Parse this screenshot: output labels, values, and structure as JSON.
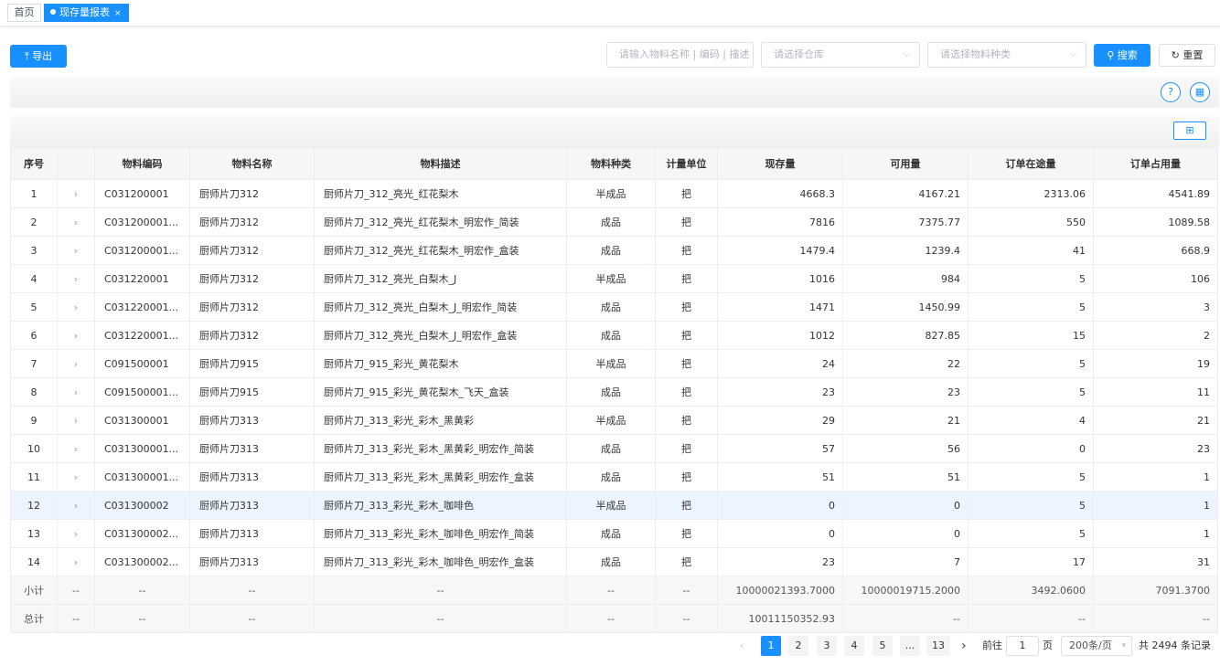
{
  "tabs": {
    "home": "首页",
    "active": "现存量报表",
    "close": "×"
  },
  "toolbar": {
    "export_label": "导出",
    "export_icon": "upload-icon",
    "search_input_placeholder": "请输入物料名称 | 编码 | 描述",
    "warehouse_placeholder": "请选择仓库",
    "material_type_placeholder": "请选择物料种类",
    "search_label": "搜索",
    "reset_label": "重置"
  },
  "table": {
    "headers": [
      "序号",
      "",
      "物料编码",
      "物料名称",
      "物料描述",
      "物料种类",
      "计量单位",
      "现存量",
      "可用量",
      "订单在途量",
      "订单占用量"
    ],
    "rows": [
      [
        "1",
        "›",
        "C031200001",
        "厨师片刀312",
        "厨师片刀_312_亮光_红花梨木",
        "半成品",
        "把",
        "4668.3",
        "4167.21",
        "2313.06",
        "4541.89"
      ],
      [
        "2",
        "›",
        "C031200001...",
        "厨师片刀312",
        "厨师片刀_312_亮光_红花梨木_明宏作_简装",
        "成品",
        "把",
        "7816",
        "7375.77",
        "550",
        "1089.58"
      ],
      [
        "3",
        "›",
        "C031200001...",
        "厨师片刀312",
        "厨师片刀_312_亮光_红花梨木_明宏作_盒装",
        "成品",
        "把",
        "1479.4",
        "1239.4",
        "41",
        "668.9"
      ],
      [
        "4",
        "›",
        "C031220001",
        "厨师片刀312",
        "厨师片刀_312_亮光_白梨木_J",
        "半成品",
        "把",
        "1016",
        "984",
        "5",
        "106"
      ],
      [
        "5",
        "›",
        "C031220001...",
        "厨师片刀312",
        "厨师片刀_312_亮光_白梨木_J_明宏作_简装",
        "成品",
        "把",
        "1471",
        "1450.99",
        "5",
        "3"
      ],
      [
        "6",
        "›",
        "C031220001...",
        "厨师片刀312",
        "厨师片刀_312_亮光_白梨木_J_明宏作_盒装",
        "成品",
        "把",
        "1012",
        "827.85",
        "15",
        "2"
      ],
      [
        "7",
        "›",
        "C091500001",
        "厨师片刀915",
        "厨师片刀_915_彩光_黄花梨木",
        "半成品",
        "把",
        "24",
        "22",
        "5",
        "19"
      ],
      [
        "8",
        "›",
        "C091500001...",
        "厨师片刀915",
        "厨师片刀_915_彩光_黄花梨木_飞天_盒装",
        "成品",
        "把",
        "23",
        "23",
        "5",
        "11"
      ],
      [
        "9",
        "›",
        "C031300001",
        "厨师片刀313",
        "厨师片刀_313_彩光_彩木_黑黄彩",
        "半成品",
        "把",
        "29",
        "21",
        "4",
        "21"
      ],
      [
        "10",
        "›",
        "C031300001...",
        "厨师片刀313",
        "厨师片刀_313_彩光_彩木_黑黄彩_明宏作_简装",
        "成品",
        "把",
        "57",
        "56",
        "0",
        "23"
      ],
      [
        "11",
        "›",
        "C031300001...",
        "厨师片刀313",
        "厨师片刀_313_彩光_彩木_黑黄彩_明宏作_盒装",
        "成品",
        "把",
        "51",
        "51",
        "5",
        "1"
      ],
      [
        "12",
        "›",
        "C031300002",
        "厨师片刀313",
        "厨师片刀_313_彩光_彩木_咖啡色",
        "半成品",
        "把",
        "0",
        "0",
        "5",
        "1"
      ],
      [
        "13",
        "›",
        "C031300002...",
        "厨师片刀313",
        "厨师片刀_313_彩光_彩木_咖啡色_明宏作_简装",
        "成品",
        "把",
        "0",
        "0",
        "5",
        "1"
      ],
      [
        "14",
        "›",
        "C031300002...",
        "厨师片刀313",
        "厨师片刀_313_彩光_彩木_咖啡色_明宏作_盒装",
        "成品",
        "把",
        "23",
        "7",
        "17",
        "31"
      ]
    ],
    "subtotal": [
      "小计",
      "--",
      "--",
      "--",
      "--",
      "--",
      "--",
      "10000021393.7000",
      "10000019715.2000",
      "3492.0600",
      "7091.3700"
    ],
    "total": [
      "总计",
      "--",
      "--",
      "--",
      "--",
      "--",
      "--",
      "10011150352.93",
      "--",
      "--",
      "--"
    ]
  },
  "pagination": {
    "pages": [
      "1",
      "2",
      "3",
      "4",
      "5",
      "...",
      "13"
    ],
    "goto_label": "前往",
    "goto_value": "1",
    "page_unit": "页",
    "page_size": "200条/页",
    "total_text": "共 2494 条记录"
  }
}
